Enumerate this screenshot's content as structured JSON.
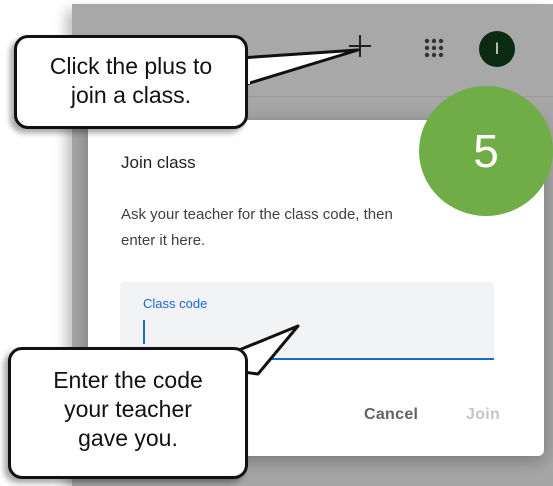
{
  "topbar": {
    "add_icon": "plus-icon",
    "apps_icon": "grid-icon",
    "avatar_initial": "I"
  },
  "dialog": {
    "title": "Join class",
    "description": "Ask your teacher for the class code, then enter it here.",
    "description_line1": "Ask your teacher for the class code, then",
    "description_line2": "enter it here.",
    "field_label": "Class code",
    "field_value": "",
    "cancel_label": "Cancel",
    "join_label": "Join"
  },
  "annotations": {
    "step_number": "5",
    "callout_plus_line1": "Click the plus to",
    "callout_plus_line2": "join a class.",
    "callout_code_line1": "Enter the code",
    "callout_code_line2": "your teacher",
    "callout_code_line3": "gave you."
  },
  "colors": {
    "accent_blue": "#1967d2",
    "step_green": "#70ad47",
    "avatar_bg": "#0b2a12"
  }
}
